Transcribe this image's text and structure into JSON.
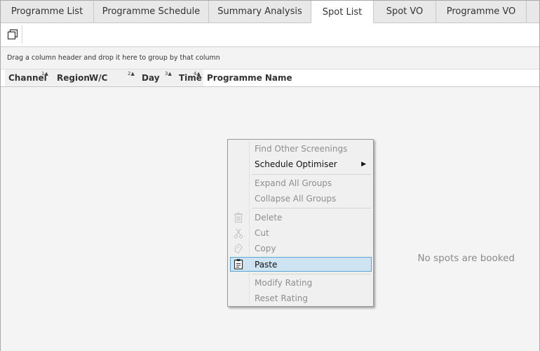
{
  "tabs": [
    {
      "label": "Programme List",
      "active": false
    },
    {
      "label": "Programme Schedule",
      "active": false
    },
    {
      "label": "Summary Analysis",
      "active": false
    },
    {
      "label": "Spot List",
      "active": true
    },
    {
      "label": "Spot VO",
      "active": false
    },
    {
      "label": "Programme VO",
      "active": false
    }
  ],
  "toolbar": {
    "restore_icon": "window-restore-icon"
  },
  "group_panel": {
    "hint": "Drag a column header and drop it here to group by that column"
  },
  "columns": [
    {
      "label": "Channel",
      "sort_index": "1"
    },
    {
      "label": "Region",
      "sort_index": ""
    },
    {
      "label": "W/C",
      "sort_index": "2"
    },
    {
      "label": "Day",
      "sort_index": "3"
    },
    {
      "label": "Time",
      "sort_index": "4"
    },
    {
      "label": "Programme Name",
      "sort_index": ""
    }
  ],
  "grid": {
    "empty_message": "No spots are booked"
  },
  "context_menu": {
    "items": [
      {
        "label": "Find Other Screenings",
        "enabled": false
      },
      {
        "label": "Schedule Optimiser",
        "enabled": true,
        "submenu": true
      },
      {
        "label": "Expand All Groups",
        "enabled": false
      },
      {
        "label": "Collapse All Groups",
        "enabled": false
      },
      {
        "label": "Delete",
        "enabled": false,
        "icon": "trash-icon"
      },
      {
        "label": "Cut",
        "enabled": false,
        "icon": "scissors-icon"
      },
      {
        "label": "Copy",
        "enabled": false,
        "icon": "copy-icon"
      },
      {
        "label": "Paste",
        "enabled": true,
        "highlighted": true,
        "icon": "clipboard-icon"
      },
      {
        "label": "Modify Rating",
        "enabled": false
      },
      {
        "label": "Reset Rating",
        "enabled": false
      }
    ]
  },
  "colors": {
    "highlight_bg": "#cfe4f2",
    "highlight_border": "#5ea4cf",
    "disabled_text": "#8e8e8e"
  }
}
